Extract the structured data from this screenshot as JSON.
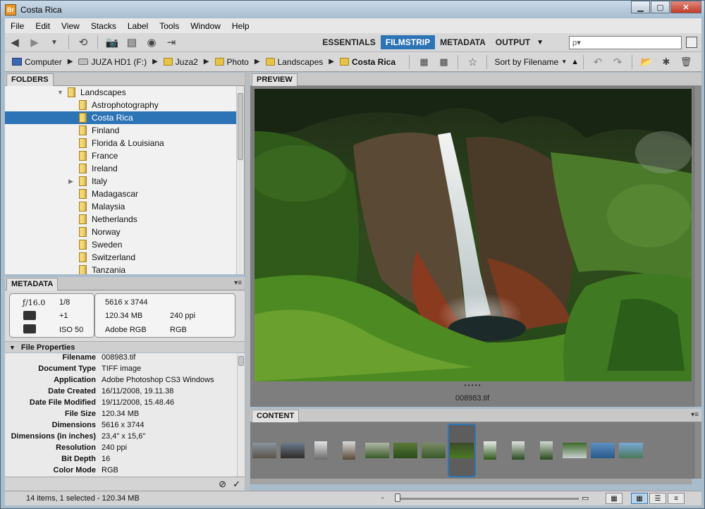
{
  "window": {
    "title": "Costa Rica",
    "app_icon": "Br"
  },
  "menu": [
    "File",
    "Edit",
    "View",
    "Stacks",
    "Label",
    "Tools",
    "Window",
    "Help"
  ],
  "workspaces": [
    {
      "label": "ESSENTIALS",
      "active": false
    },
    {
      "label": "FILMSTRIP",
      "active": true
    },
    {
      "label": "METADATA",
      "active": false
    },
    {
      "label": "OUTPUT",
      "active": false
    }
  ],
  "search": {
    "placeholder": "ρ▾"
  },
  "breadcrumb": [
    "Computer",
    "JUZA HD1 (F:)",
    "Juza2",
    "Photo",
    "Landscapes",
    "Costa Rica"
  ],
  "sort": {
    "label": "Sort by Filename"
  },
  "panels": {
    "folders": "FOLDERS",
    "metadata": "METADATA",
    "preview": "PREVIEW",
    "content": "CONTENT"
  },
  "folders": {
    "parent": "Landscapes",
    "items": [
      "Astrophotography",
      "Costa Rica",
      "Finland",
      "Florida & Louisiana",
      "France",
      "Ireland",
      "Italy",
      "Madagascar",
      "Malaysia",
      "Netherlands",
      "Norway",
      "Sweden",
      "Switzerland",
      "Tanzania"
    ],
    "selected": "Costa Rica"
  },
  "camera": {
    "aperture": "ƒ/16.0",
    "shutter": "1/8",
    "exposure_comp": "+1",
    "iso": "ISO 50"
  },
  "image_info": {
    "dimensions": "5616 x 3744",
    "size": "120.34 MB",
    "ppi": "240 ppi",
    "profile": "Adobe RGB",
    "mode": "RGB"
  },
  "file_properties": {
    "header": "File Properties",
    "rows": [
      {
        "key": "Filename",
        "value": "008983.tif"
      },
      {
        "key": "Document Type",
        "value": "TIFF image"
      },
      {
        "key": "Application",
        "value": "Adobe Photoshop CS3 Windows"
      },
      {
        "key": "Date Created",
        "value": "16/11/2008, 19.11.38"
      },
      {
        "key": "Date File Modified",
        "value": "19/11/2008, 15.48.46"
      },
      {
        "key": "File Size",
        "value": "120.34 MB"
      },
      {
        "key": "Dimensions",
        "value": "5616 x 3744"
      },
      {
        "key": "Dimensions (in inches)",
        "value": "23,4\" x 15,6\""
      },
      {
        "key": "Resolution",
        "value": "240 ppi"
      },
      {
        "key": "Bit Depth",
        "value": "16"
      },
      {
        "key": "Color Mode",
        "value": "RGB"
      }
    ]
  },
  "preview": {
    "dots": "• • • • •",
    "filename": "008983.tif"
  },
  "status": {
    "text": "14 items, 1 selected - 120.34 MB"
  },
  "icons": {
    "back": "back-arrow-icon",
    "forward": "forward-arrow-icon"
  }
}
